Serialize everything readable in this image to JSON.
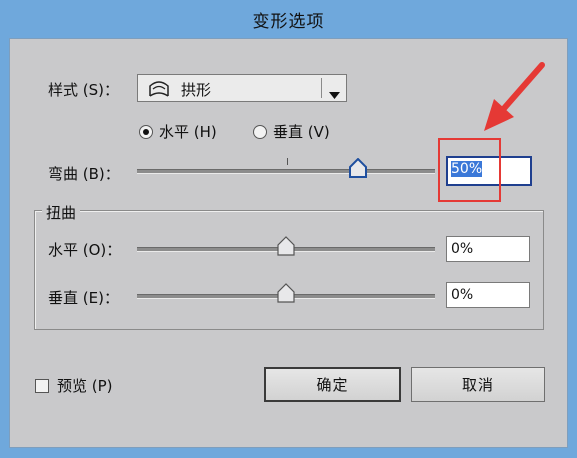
{
  "window": {
    "title": "变形选项"
  },
  "style_row": {
    "label": "样式 (S)：",
    "selected": "拱形"
  },
  "orientation": {
    "horizontal": {
      "label": "水平 (H)",
      "checked": true
    },
    "vertical": {
      "label": "垂直 (V)",
      "checked": false
    }
  },
  "bend": {
    "label": "弯曲 (B)：",
    "value": "50%"
  },
  "distortion": {
    "title": "扭曲",
    "horizontal": {
      "label": "水平 (O)：",
      "value": "0%"
    },
    "vertical": {
      "label": "垂直 (E)：",
      "value": "0%"
    }
  },
  "preview": {
    "label": "预览 (P)",
    "checked": false
  },
  "buttons": {
    "ok": "确定",
    "cancel": "取消"
  },
  "colors": {
    "titlebar": "#6fa8dc",
    "panel": "#c9c9cb",
    "selection": "#3b78d8",
    "annotation": "#e53935"
  },
  "icons": {
    "style": "arc-warp-icon",
    "dropdown": "triangle-down-icon",
    "annotation": "red-arrow-icon"
  }
}
